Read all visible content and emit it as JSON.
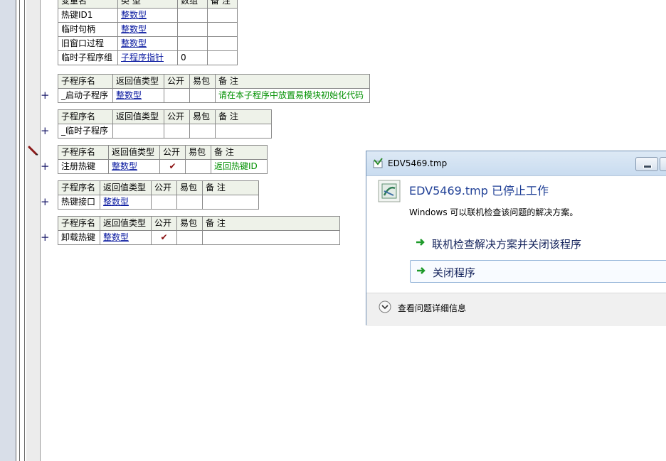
{
  "var_table": {
    "header": [
      "变量名",
      "类 型",
      "数组",
      "备 注"
    ],
    "rows": [
      [
        "热键ID1",
        "整数型",
        "",
        ""
      ],
      [
        "临时句柄",
        "整数型",
        "",
        ""
      ],
      [
        "旧窗口过程",
        "整数型",
        "",
        ""
      ],
      [
        "临时子程序组",
        "子程序指针",
        "0",
        ""
      ]
    ]
  },
  "sub_header": [
    "子程序名",
    "返回值类型",
    "公开",
    "易包",
    "备 注"
  ],
  "subs": [
    {
      "name": "_启动子程序",
      "ret": "整数型",
      "public": "",
      "epkg": "",
      "note": "请在本子程序中放置易模块初始化代码"
    },
    {
      "name": "_临时子程序",
      "ret": "",
      "public": "",
      "epkg": "",
      "note": ""
    },
    {
      "name": "注册热键",
      "ret": "整数型",
      "public": "✔",
      "epkg": "",
      "note": "返回热键ID"
    },
    {
      "name": "热键接口",
      "ret": "整数型",
      "public": "",
      "epkg": "",
      "note": ""
    },
    {
      "name": "卸载热键",
      "ret": "整数型",
      "public": "✔",
      "epkg": "",
      "note": ""
    }
  ],
  "plus_label": "+",
  "dialog": {
    "title": "EDV5469.tmp",
    "heading": "EDV5469.tmp 已停止工作",
    "subtext": "Windows 可以联机检查该问题的解决方案。",
    "option1": "联机检查解决方案并关闭该程序",
    "option2": "关闭程序",
    "details": "查看问题详细信息"
  },
  "colors": {
    "type_link": "#0a1aa0",
    "note_green": "#009000",
    "dialog_heading": "#1f3f96"
  }
}
